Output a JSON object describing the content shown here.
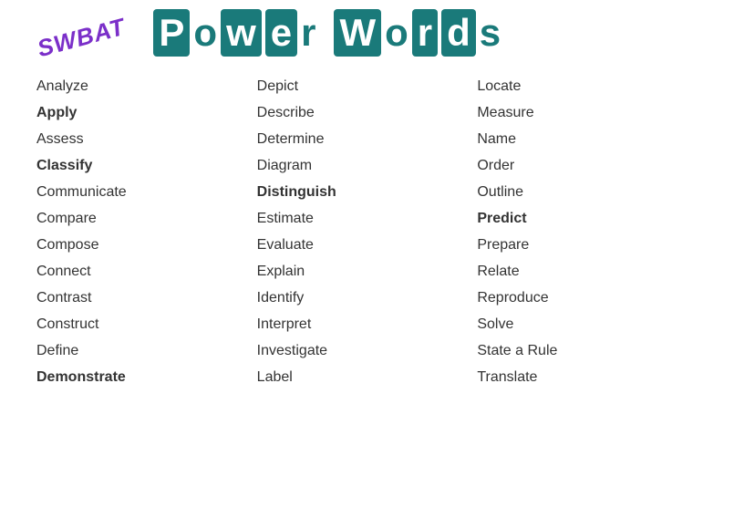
{
  "header": {
    "swbat": "SWBAT",
    "title_letters": [
      {
        "char": "P",
        "box": true
      },
      {
        "char": "o",
        "box": false
      },
      {
        "char": "w",
        "box": true
      },
      {
        "char": "e",
        "box": true
      },
      {
        "char": "r",
        "box": false
      },
      {
        "char": " ",
        "box": false
      },
      {
        "char": "W",
        "box": true
      },
      {
        "char": "o",
        "box": false
      },
      {
        "char": "r",
        "box": true
      },
      {
        "char": "d",
        "box": true
      },
      {
        "char": "s",
        "box": false
      }
    ]
  },
  "columns": [
    {
      "id": "col1",
      "words": [
        {
          "text": "Analyze",
          "bold": false
        },
        {
          "text": "Apply",
          "bold": true
        },
        {
          "text": "Assess",
          "bold": false
        },
        {
          "text": "Classify",
          "bold": true
        },
        {
          "text": "Communicate",
          "bold": false
        },
        {
          "text": "Compare",
          "bold": false
        },
        {
          "text": "Compose",
          "bold": false
        },
        {
          "text": "Connect",
          "bold": false
        },
        {
          "text": "Contrast",
          "bold": false
        },
        {
          "text": "Construct",
          "bold": false
        },
        {
          "text": "Define",
          "bold": false
        },
        {
          "text": "Demonstrate",
          "bold": true
        }
      ]
    },
    {
      "id": "col2",
      "words": [
        {
          "text": "Depict",
          "bold": false
        },
        {
          "text": "Describe",
          "bold": false
        },
        {
          "text": "Determine",
          "bold": false
        },
        {
          "text": "Diagram",
          "bold": false
        },
        {
          "text": "Distinguish",
          "bold": true
        },
        {
          "text": "Estimate",
          "bold": false
        },
        {
          "text": "Evaluate",
          "bold": false
        },
        {
          "text": "Explain",
          "bold": false
        },
        {
          "text": "Identify",
          "bold": false
        },
        {
          "text": "Interpret",
          "bold": false
        },
        {
          "text": "Investigate",
          "bold": false
        },
        {
          "text": "Label",
          "bold": false
        }
      ]
    },
    {
      "id": "col3",
      "words": [
        {
          "text": "Locate",
          "bold": false
        },
        {
          "text": "Measure",
          "bold": false
        },
        {
          "text": "Name",
          "bold": false
        },
        {
          "text": "Order",
          "bold": false
        },
        {
          "text": "Outline",
          "bold": false
        },
        {
          "text": "Predict",
          "bold": true
        },
        {
          "text": "Prepare",
          "bold": false
        },
        {
          "text": "Relate",
          "bold": false
        },
        {
          "text": "Reproduce",
          "bold": false
        },
        {
          "text": "Solve",
          "bold": false
        },
        {
          "text": "State a Rule",
          "bold": false
        },
        {
          "text": "Translate",
          "bold": false
        }
      ]
    }
  ]
}
